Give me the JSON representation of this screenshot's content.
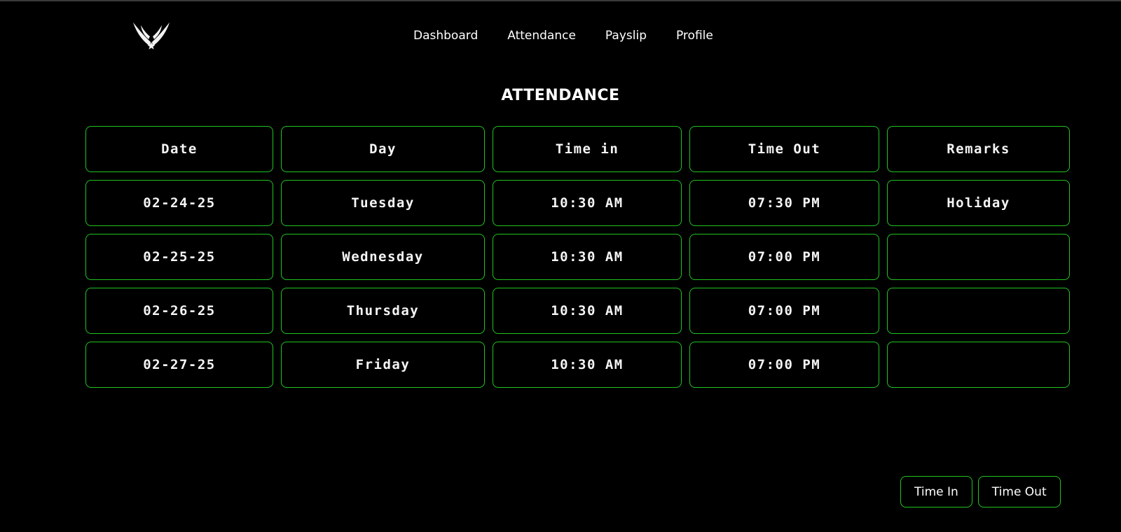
{
  "nav": {
    "items": [
      {
        "label": "Dashboard"
      },
      {
        "label": "Attendance"
      },
      {
        "label": "Payslip"
      },
      {
        "label": "Profile"
      }
    ]
  },
  "page": {
    "title": "ATTENDANCE"
  },
  "table": {
    "headers": [
      "Date",
      "Day",
      "Time in",
      "Time Out",
      "Remarks"
    ],
    "rows": [
      [
        "02-24-25",
        "Tuesday",
        "10:30 AM",
        "07:30 PM",
        "Holiday"
      ],
      [
        "02-25-25",
        "Wednesday",
        "10:30 AM",
        "07:00 PM",
        ""
      ],
      [
        "02-26-25",
        "Thursday",
        "10:30 AM",
        "07:00 PM",
        ""
      ],
      [
        "02-27-25",
        "Friday",
        "10:30 AM",
        "07:00 PM",
        ""
      ]
    ]
  },
  "actions": {
    "time_in_label": "Time In",
    "time_out_label": "Time Out"
  },
  "theme": {
    "background": "#000000",
    "accent_border": "#21c421",
    "text": "#ffffff"
  },
  "logo": {
    "icon": "winged-star-logo-icon"
  }
}
